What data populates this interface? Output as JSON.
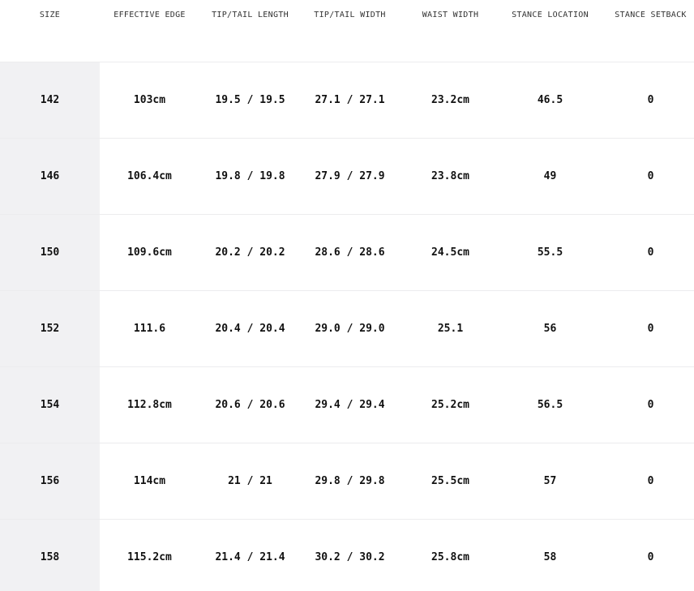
{
  "table": {
    "headers": [
      "SIZE",
      "EFFECTIVE EDGE",
      "TIP/TAIL LENGTH",
      "TIP/TAIL WIDTH",
      "WAIST WIDTH",
      "STANCE LOCATION",
      "STANCE SETBACK"
    ],
    "rows": [
      [
        "142",
        "103cm",
        "19.5 / 19.5",
        "27.1 / 27.1",
        "23.2cm",
        "46.5",
        "0"
      ],
      [
        "146",
        "106.4cm",
        "19.8 / 19.8",
        "27.9 / 27.9",
        "23.8cm",
        "49",
        "0"
      ],
      [
        "150",
        "109.6cm",
        "20.2 / 20.2",
        "28.6 / 28.6",
        "24.5cm",
        "55.5",
        "0"
      ],
      [
        "152",
        "111.6",
        "20.4 / 20.4",
        "29.0 / 29.0",
        "25.1",
        "56",
        "0"
      ],
      [
        "154",
        "112.8cm",
        "20.6 / 20.6",
        "29.4 / 29.4",
        "25.2cm",
        "56.5",
        "0"
      ],
      [
        "156",
        "114cm",
        "21 / 21",
        "29.8 / 29.8",
        "25.5cm",
        "57",
        "0"
      ],
      [
        "158",
        "115.2cm",
        "21.4 / 21.4",
        "30.2 / 30.2",
        "25.8cm",
        "58",
        "0"
      ]
    ]
  }
}
